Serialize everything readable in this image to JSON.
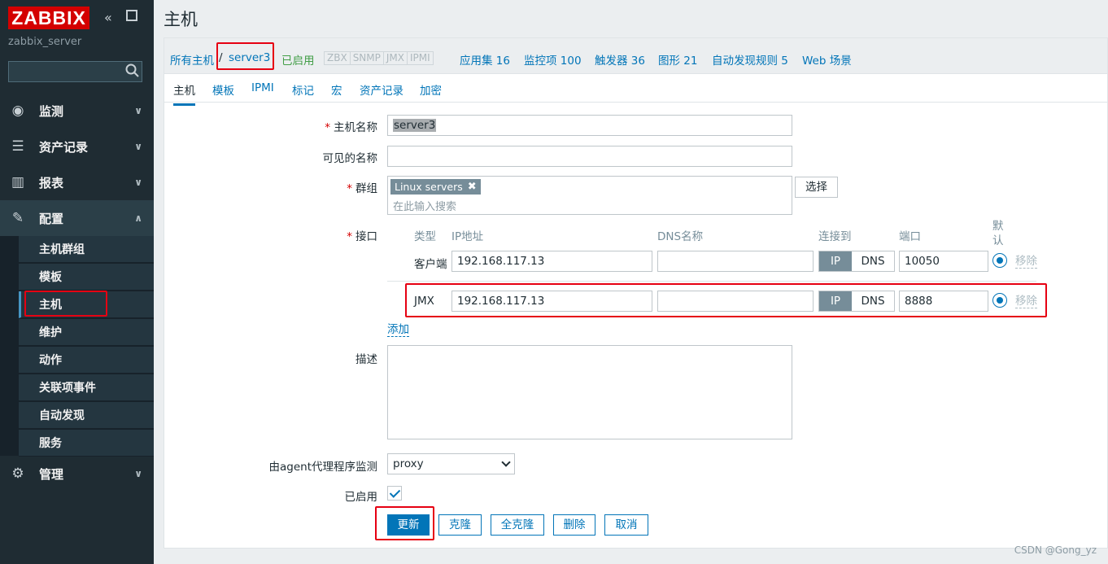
{
  "sidebar": {
    "logo": "ZABBIX",
    "server_name": "zabbix_server",
    "search_placeholder": "",
    "menu": [
      {
        "label": "监测",
        "icon": "eye-icon"
      },
      {
        "label": "资产记录",
        "icon": "list-icon"
      },
      {
        "label": "报表",
        "icon": "bar-chart-icon"
      },
      {
        "label": "配置",
        "icon": "wrench-icon"
      },
      {
        "label": "管理",
        "icon": "gear-icon"
      }
    ],
    "config_submenu": [
      "主机群组",
      "模板",
      "主机",
      "维护",
      "动作",
      "关联项事件",
      "自动发现",
      "服务"
    ]
  },
  "page": {
    "title": "主机"
  },
  "breadcrumbs": {
    "all_hosts": "所有主机",
    "separator": "/",
    "host": "server3",
    "status": "已启用",
    "availability": [
      "ZBX",
      "SNMP",
      "JMX",
      "IPMI"
    ],
    "applications": "应用集 16",
    "items": "监控项 100",
    "triggers": "触发器 36",
    "graphs": "图形 21",
    "discovery": "自动发现规则 5",
    "web": "Web 场景"
  },
  "tabs": [
    "主机",
    "模板",
    "IPMI",
    "标记",
    "宏",
    "资产记录",
    "加密"
  ],
  "form": {
    "hostname_label": "主机名称",
    "hostname_value": "server3",
    "visible_name_label": "可见的名称",
    "visible_name_value": "",
    "groups_label": "群组",
    "group_chip": "Linux servers",
    "groups_placeholder": "在此输入搜索",
    "select_button": "选择",
    "interfaces_label": "接口",
    "iface_headers": {
      "type": "类型",
      "ip": "IP地址",
      "dns": "DNS名称",
      "connect": "连接到",
      "port": "端口",
      "default": "默认"
    },
    "interfaces": [
      {
        "type": "客户端",
        "ip": "192.168.117.13",
        "dns": "",
        "connect_ip": "IP",
        "connect_dns": "DNS",
        "port": "10050",
        "remove": "移除"
      },
      {
        "type": "JMX",
        "ip": "192.168.117.13",
        "dns": "",
        "connect_ip": "IP",
        "connect_dns": "DNS",
        "port": "8888",
        "remove": "移除"
      }
    ],
    "add_link": "添加",
    "description_label": "描述",
    "description_value": "",
    "proxy_label": "由agent代理程序监测",
    "proxy_value": "proxy",
    "enabled_label": "已启用",
    "enabled": true,
    "buttons": {
      "update": "更新",
      "clone": "克隆",
      "full_clone": "全克隆",
      "delete": "删除",
      "cancel": "取消"
    }
  },
  "watermark": "CSDN @Gong_yz"
}
